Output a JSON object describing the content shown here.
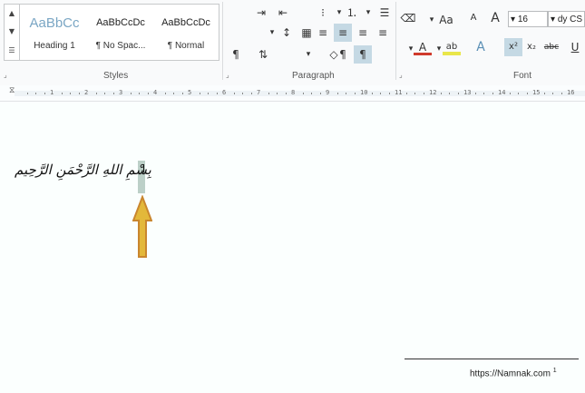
{
  "ribbon": {
    "groups": {
      "styles": "Styles",
      "paragraph": "Paragraph",
      "font": "Font"
    },
    "styles_gallery": [
      {
        "sample": "AaBbCcDc",
        "name": "¶ Normal"
      },
      {
        "sample": "AaBbCcDc",
        "name": "¶ No Spac..."
      },
      {
        "sample": "AaBbCc",
        "name": "Heading 1"
      }
    ],
    "font": {
      "name": "Tahoma (Body CS)",
      "name_visible": "dy CS",
      "size": "16",
      "grow_label": "A",
      "shrink_label": "A",
      "case_label": "Aa",
      "clear_label": "A",
      "strike_label": "abc",
      "sub_label": "x₂",
      "super_label": "x²",
      "text_effects_label": "A",
      "highlight_label": "ab",
      "font_color_label": "A",
      "underline_label": "U"
    },
    "colors": {
      "highlight_yellow": "#e9e64a",
      "font_red": "#d03a2c",
      "selected_bg": "#c5d9e4"
    }
  },
  "ruler": {
    "numbers": [
      "1",
      "2",
      "3",
      "4",
      "5",
      "6",
      "7",
      "8",
      "9",
      "10",
      "11",
      "12",
      "13",
      "14",
      "15",
      "16"
    ]
  },
  "document": {
    "main_text": "بِسْمِ اللهِ الرَّحْمَنِ الرَّحِيم",
    "footnote_mark": "1",
    "footnote_text": "https://Namnak.com",
    "arrow_color": "#e3b83a"
  }
}
